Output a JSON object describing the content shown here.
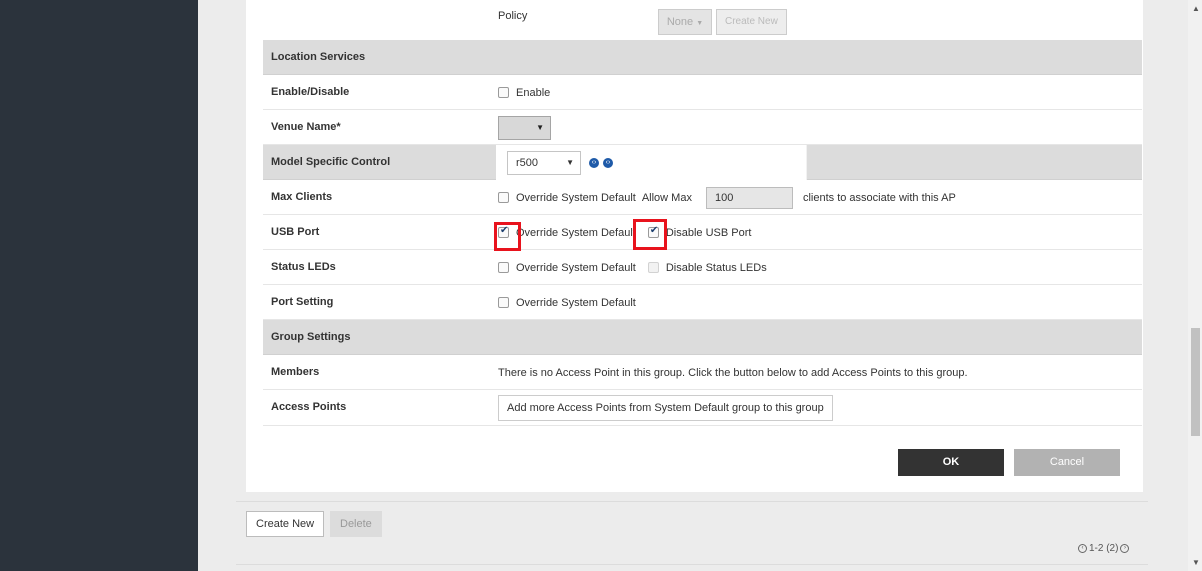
{
  "policy_row": {
    "label": "Policy",
    "select_value": "None",
    "select_arrow": "▼",
    "create_new": "Create New"
  },
  "sections": {
    "location": "Location Services",
    "group": "Group Settings"
  },
  "rows": {
    "enable_disable": {
      "label": "Enable/Disable",
      "checkbox_label": "Enable",
      "checked": false
    },
    "venue_name": {
      "label": "Venue Name*",
      "arrow": "▼"
    },
    "model_specific": {
      "label": "Model Specific Control",
      "model": "r500",
      "arrow": "▼"
    },
    "max_clients": {
      "label": "Max Clients",
      "override_label": "Override System Default",
      "allow_label": "Allow Max",
      "value": "100",
      "suffix": "clients to associate with this AP"
    },
    "usb_port": {
      "label": "USB Port",
      "override_label": "Override System Default",
      "disable_label": "Disable USB Port",
      "override_checked": true,
      "disable_checked": true
    },
    "status_leds": {
      "label": "Status LEDs",
      "override_label": "Override System Default",
      "disable_label": "Disable Status LEDs"
    },
    "port_setting": {
      "label": "Port Setting",
      "override_label": "Override System Default"
    },
    "members": {
      "label": "Members",
      "text": "There is no Access Point in this group. Click the button below to add Access Points to this group."
    },
    "access_points": {
      "label": "Access Points",
      "button": "Add more Access Points from System Default group to this group"
    }
  },
  "actions": {
    "ok": "OK",
    "cancel": "Cancel"
  },
  "footer": {
    "create_new": "Create New",
    "delete": "Delete",
    "pager_text": "1-2 (2)"
  },
  "icons": {
    "model_icons": [
      "previous-icon",
      "next-icon"
    ],
    "pager_icons": [
      "pager-prev-icon",
      "pager-next-icon"
    ],
    "scroll": [
      "scroll-up-icon",
      "scroll-down-icon"
    ]
  },
  "colors": {
    "sidebar": "#2b333c",
    "section_header": "#dcdcdc",
    "ok_button": "#333333",
    "cancel_button": "#b2b2b2",
    "highlight": "#e8131d",
    "link_icon": "#1e5aa8"
  }
}
